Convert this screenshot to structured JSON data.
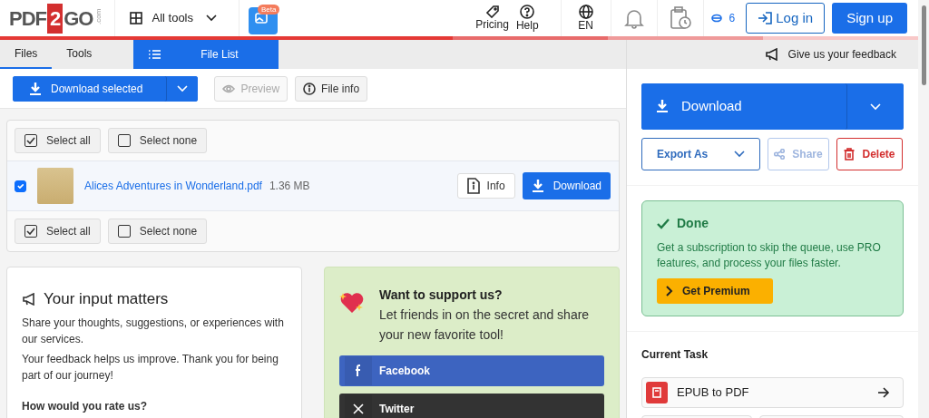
{
  "header": {
    "logo": {
      "left": "PDF",
      "mid": "2",
      "right": "GO",
      "suffix": ".com"
    },
    "all_tools": "All tools",
    "ai_badge": "Beta",
    "links": [
      {
        "label": "Pricing",
        "kind": "tag"
      },
      {
        "label": "Help",
        "kind": "help"
      }
    ],
    "language": "EN",
    "credits": "6",
    "login": "Log in",
    "signup": "Sign up"
  },
  "tabs": [
    {
      "label": "Files",
      "selected": true
    },
    {
      "label": "Tools",
      "selected": false
    }
  ],
  "file_list_tab": "File List",
  "feedback_link": "Give us your feedback",
  "toolbar": {
    "download_selected": "Download selected",
    "preview": {
      "label": "Preview",
      "disabled": true
    },
    "file_info": {
      "label": "File info",
      "disabled": false
    }
  },
  "select_buttons_top": [
    {
      "label": "Select all",
      "kind": "all"
    },
    {
      "label": "Select none",
      "kind": "none"
    }
  ],
  "files": [
    {
      "name": "Alices Adventures in Wonderland.pdf",
      "size": "1.36 MB",
      "checked": true,
      "info": "Info",
      "download": "Download"
    }
  ],
  "select_buttons_bottom": [
    {
      "label": "Select all",
      "kind": "all"
    },
    {
      "label": "Select none",
      "kind": "none"
    }
  ],
  "feedback_card": {
    "title": "Your input matters",
    "paragraphs": [
      "Share your thoughts, suggestions, or experiences with our services.",
      "Your feedback helps us improve. Thank you for being part of our journey!"
    ],
    "rating_question": "How would you rate us?"
  },
  "support_card": {
    "title": "Want to support us?",
    "text": "Let friends in on the secret and share your new favorite tool!",
    "buttons": [
      {
        "label": "Facebook",
        "kind": "facebook"
      },
      {
        "label": "Twitter",
        "kind": "twitter"
      }
    ]
  },
  "side": {
    "download": "Download",
    "export": "Export As",
    "share": {
      "label": "Share",
      "disabled": true
    },
    "delete": "Delete",
    "status": {
      "title": "Done",
      "text": "Get a subscription to skip the queue, use PRO features, and process your files faster.",
      "button": "Get Premium"
    },
    "current_task_title": "Current Task",
    "tasks": [
      {
        "label": "EPUB to PDF"
      }
    ]
  }
}
